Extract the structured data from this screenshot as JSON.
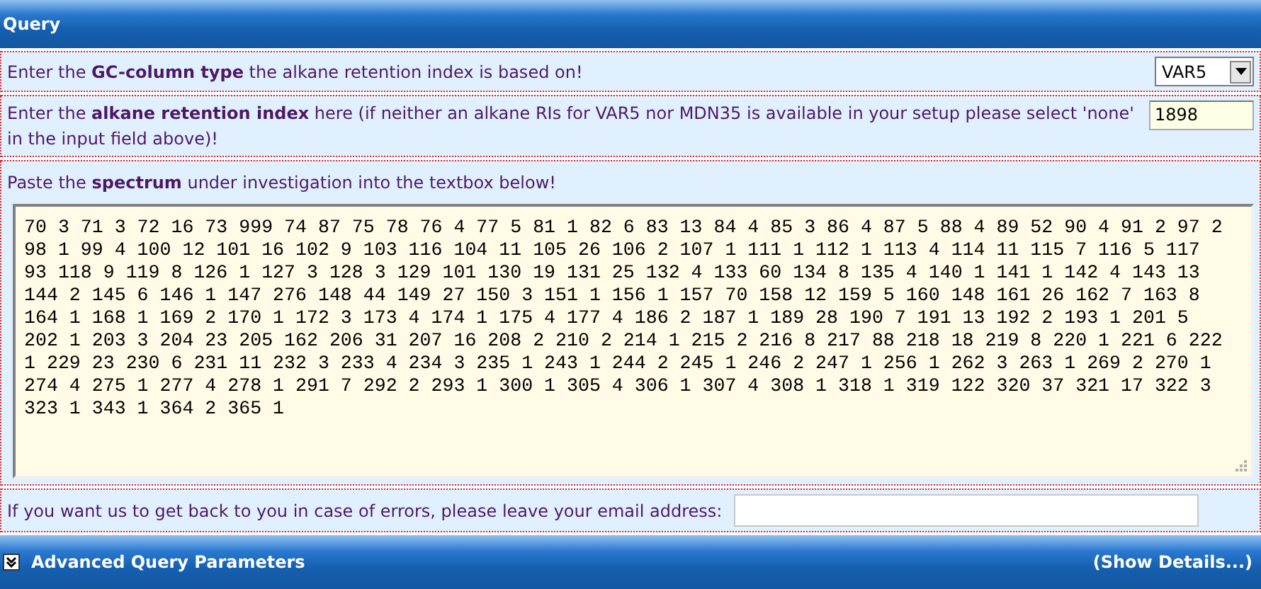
{
  "header": {
    "title": "Query"
  },
  "column_type": {
    "label": "Enter the **GC-column type** the alkane retention index is based on!",
    "value": "VAR5"
  },
  "retention_index": {
    "label": "Enter the **alkane retention index** here (if neither an alkane RIs for VAR5 nor MDN35 is available in your setup please select 'none' in the input field above)!",
    "value": "1898"
  },
  "spectrum": {
    "label": "Paste the **spectrum** under investigation into the textbox below!",
    "lines": [
      "70 3 71 3 72 16 73 999 74 87 75 78 76 4 77 5 81 1 82 6 83 13 84 4 85 3 86 4 87 5 88 4 89 52 90 4 91 2 97 2",
      "98 1 99 4 100 12 101 16 102 9 103 116 104 11 105 26 106 2 107 1 111 1 112 1 113 4 114 11 115 7 116 5 117",
      "93 118 9 119 8 126 1 127 3 128 3 129 101 130 19 131 25 132 4 133 60 134 8 135 4 140 1 141 1 142 4 143 13",
      "144 2 145 6 146 1 147 276 148 44 149 27 150 3 151 1 156 1 157 70 158 12 159 5 160 148 161 26 162 7 163 8",
      "164 1 168 1 169 2 170 1 172 3 173 4 174 1 175 4 177 4 186 2 187 1 189 28 190 7 191 13 192 2 193 1 201 5",
      "202 1 203 3 204 23 205 162 206 31 207 16 208 2 210 2 214 1 215 2 216 8 217 88 218 18 219 8 220 1 221 6 222",
      "1 229 23 230 6 231 11 232 3 233 4 234 3 235 1 243 1 244 2 245 1 246 2 247 1 256 1 262 3 263 1 269 2 270 1",
      "274 4 275 1 277 4 278 1 291 7 292 2 293 1 300 1 305 4 306 1 307 4 308 1 318 1 319 122 320 37 321 17 322 3",
      "323 1 343 1 364 2 365 1"
    ]
  },
  "email": {
    "label": "If you want us to get back to you in case of errors, please leave your email address:"
  },
  "advanced": {
    "title": "Advanced Query Parameters",
    "expanded": false,
    "link": "(Show Details...)"
  }
}
